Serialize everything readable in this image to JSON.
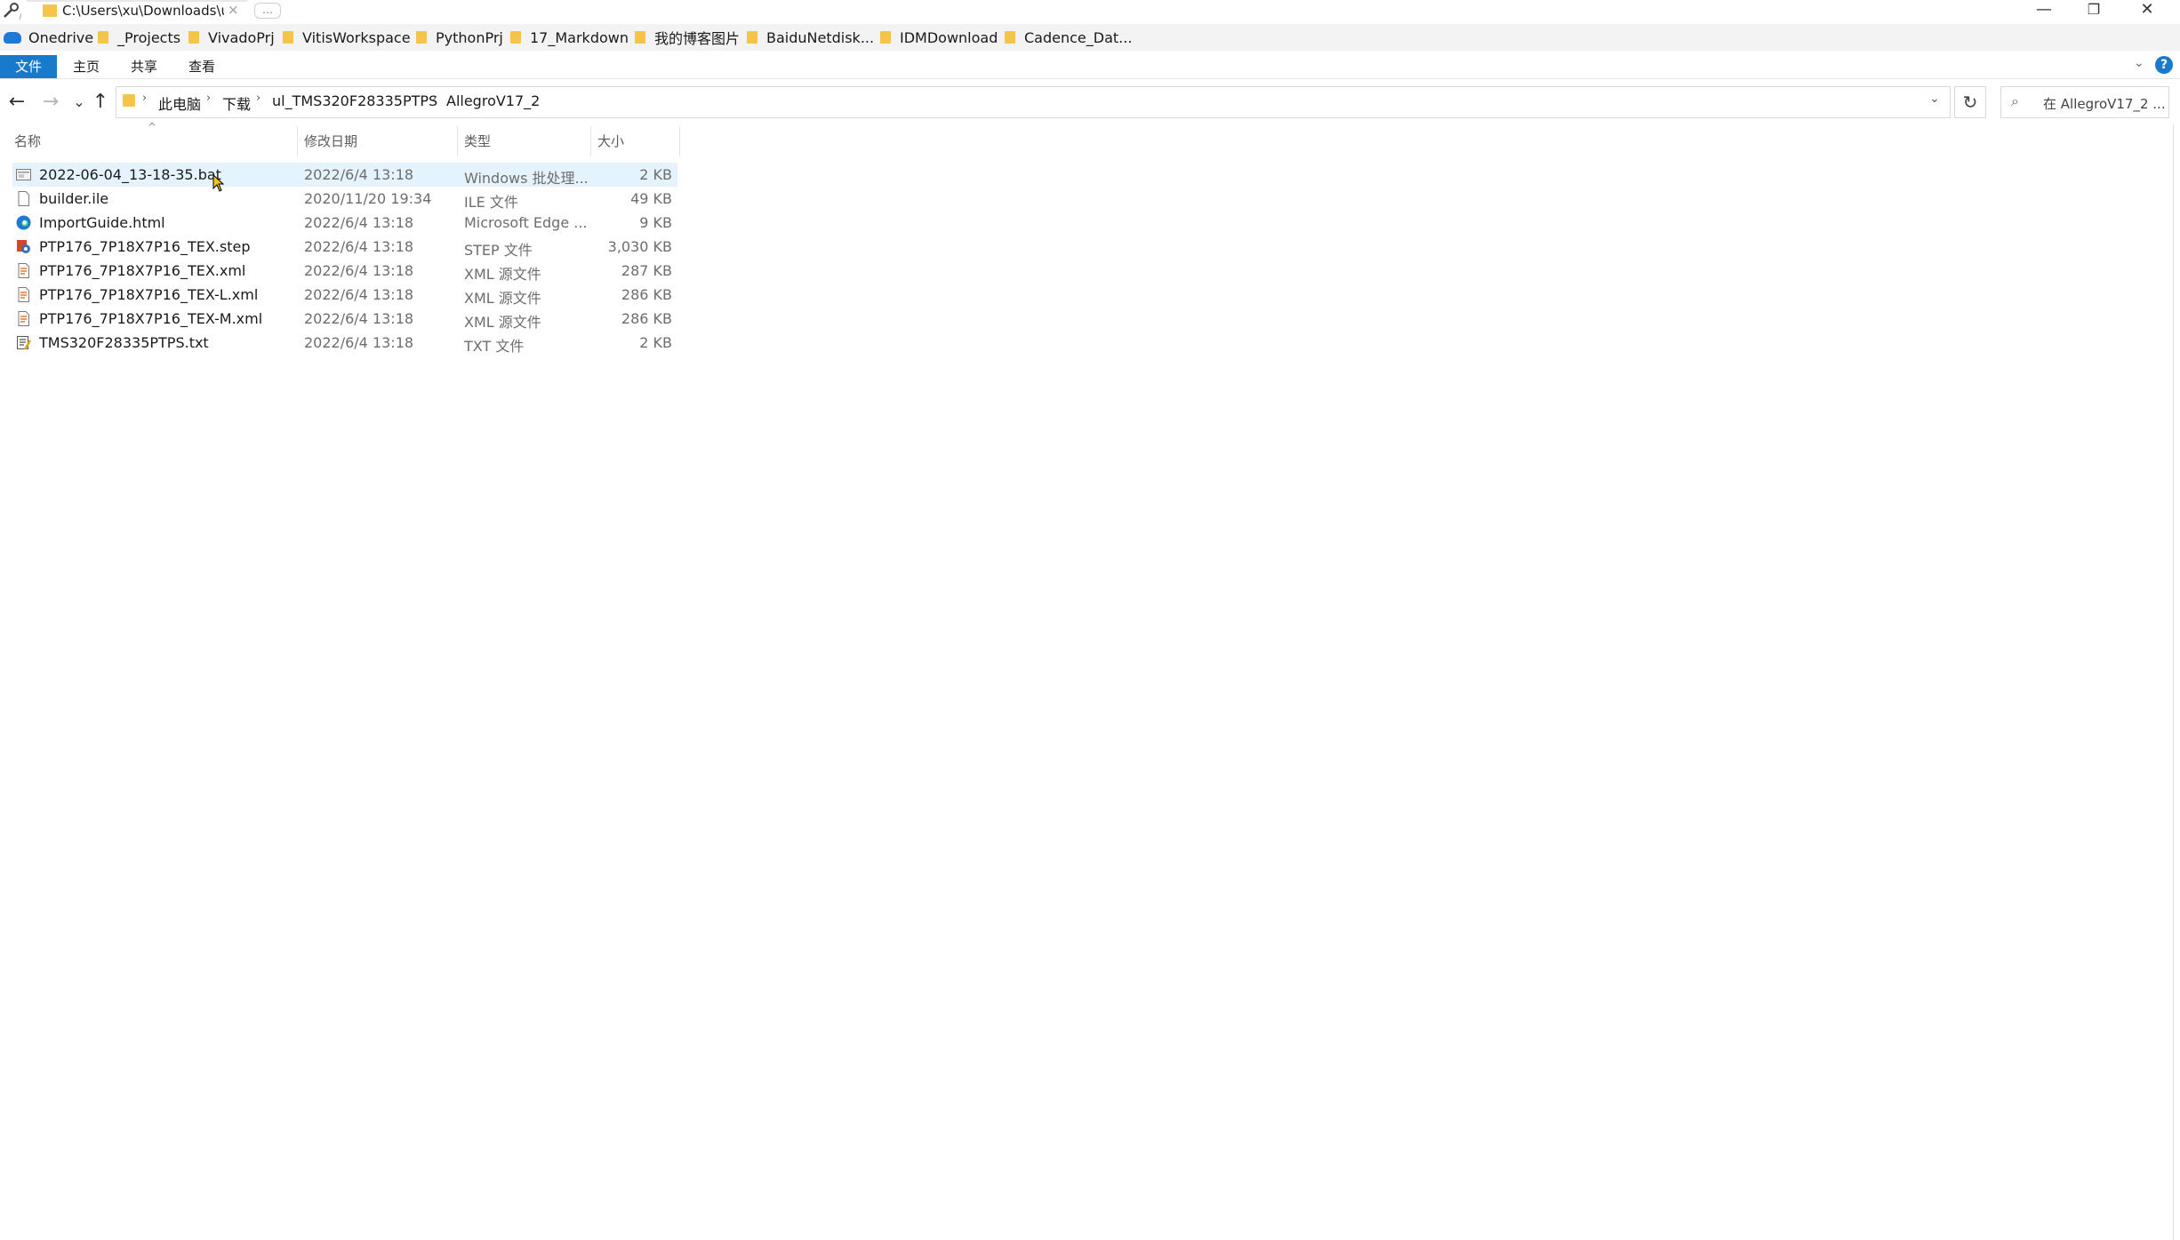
{
  "tab": {
    "title": "C:\\Users\\xu\\Downloads\\u",
    "close": "×",
    "new_tab": "…"
  },
  "window": {
    "minimize": "—",
    "maximize": "❐",
    "close": "✕"
  },
  "favorites": [
    "Onedrive",
    "_Projects",
    "VivadoPrj",
    "VitisWorkspace",
    "PythonPrj",
    "17_Markdown",
    "我的博客图片",
    "BaiduNetdisk...",
    "IDMDownload",
    "Cadence_Dat..."
  ],
  "ribbon": {
    "file": "文件",
    "home": "主页",
    "share": "共享",
    "view": "查看",
    "help": "?"
  },
  "nav": {
    "back": "←",
    "forward": "→",
    "recent": "⌄",
    "up": "↑"
  },
  "breadcrumb": [
    "此电脑",
    "下载",
    "ul_TMS320F28335PTPS",
    "AllegroV17_2"
  ],
  "search": {
    "placeholder": "在 AllegroV17_2 ..."
  },
  "columns": {
    "name": "名称",
    "date": "修改日期",
    "type": "类型",
    "size": "大小"
  },
  "files": [
    {
      "name": "2022-06-04_13-18-35.bat",
      "date": "2022/6/4 13:18",
      "type": "Windows 批处理...",
      "size": "2 KB",
      "icon": "batch-file-icon"
    },
    {
      "name": "builder.ile",
      "date": "2020/11/20 19:34",
      "type": "ILE 文件",
      "size": "49 KB",
      "icon": "generic-file-icon"
    },
    {
      "name": "ImportGuide.html",
      "date": "2022/6/4 13:18",
      "type": "Microsoft Edge ...",
      "size": "9 KB",
      "icon": "edge-html-icon"
    },
    {
      "name": "PTP176_7P18X7P16_TEX.step",
      "date": "2022/6/4 13:18",
      "type": "STEP 文件",
      "size": "3,030 KB",
      "icon": "step-file-icon"
    },
    {
      "name": "PTP176_7P18X7P16_TEX.xml",
      "date": "2022/6/4 13:18",
      "type": "XML 源文件",
      "size": "287 KB",
      "icon": "xml-file-icon"
    },
    {
      "name": "PTP176_7P18X7P16_TEX-L.xml",
      "date": "2022/6/4 13:18",
      "type": "XML 源文件",
      "size": "286 KB",
      "icon": "xml-file-icon"
    },
    {
      "name": "PTP176_7P18X7P16_TEX-M.xml",
      "date": "2022/6/4 13:18",
      "type": "XML 源文件",
      "size": "286 KB",
      "icon": "xml-file-icon"
    },
    {
      "name": "TMS320F28335PTPS.txt",
      "date": "2022/6/4 13:18",
      "type": "TXT 文件",
      "size": "2 KB",
      "icon": "text-file-icon"
    }
  ],
  "colors": {
    "accent": "#1979ca",
    "folder": "#f5c54a",
    "selection": "#cce8ff"
  }
}
